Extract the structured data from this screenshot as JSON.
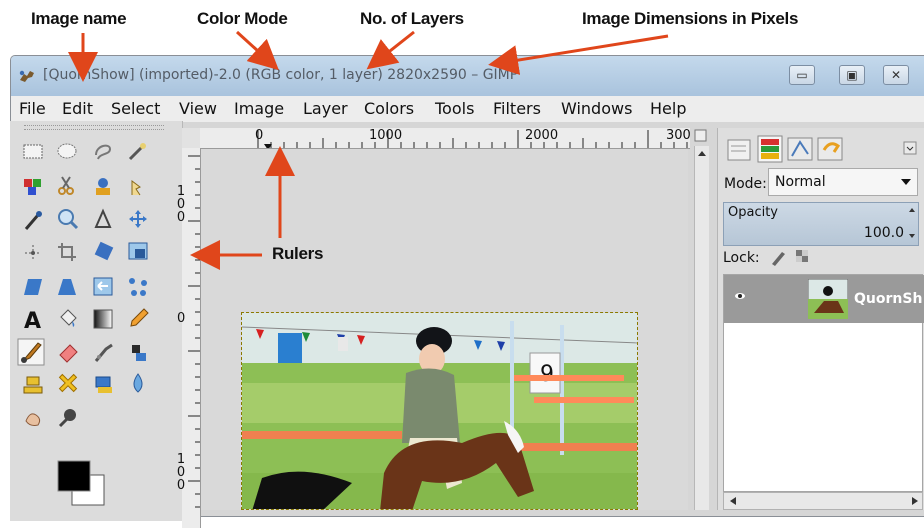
{
  "annotations": [
    {
      "key": "image_name",
      "label": "Image name"
    },
    {
      "key": "color_mode",
      "label": "Color Mode"
    },
    {
      "key": "layers",
      "label": "No. of Layers"
    },
    {
      "key": "dimensions",
      "label": "Image Dimensions in Pixels"
    },
    {
      "key": "rulers",
      "label": "Rulers"
    }
  ],
  "window": {
    "title": "[QuornShow] (imported)-2.0 (RGB color, 1 layer) 2820x2590 – GIMP",
    "minimize_glyph": "▭",
    "maximize_glyph": "▣",
    "close_glyph": "✕"
  },
  "menubar": {
    "items": [
      "File",
      "Edit",
      "Select",
      "View",
      "Image",
      "Layer",
      "Colors",
      "Tools",
      "Filters",
      "Windows",
      "Help"
    ]
  },
  "ruler": {
    "h_labels": [
      "0",
      "1000",
      "2000",
      "300"
    ],
    "v_labels": [
      "100",
      "0",
      "100"
    ]
  },
  "layers_panel": {
    "mode_label": "Mode:",
    "mode_value": "Normal",
    "opacity_label": "Opacity",
    "opacity_value": "100.0",
    "lock_label": "Lock:",
    "layer_name": "QuornSh",
    "layer_visibility_glyph": "👁"
  },
  "photo": {
    "bib_number": "9"
  },
  "colors": {
    "arrow": "#e0461b",
    "titlebar": "#b8d0e8",
    "layer_row": "#9a9a9a"
  }
}
